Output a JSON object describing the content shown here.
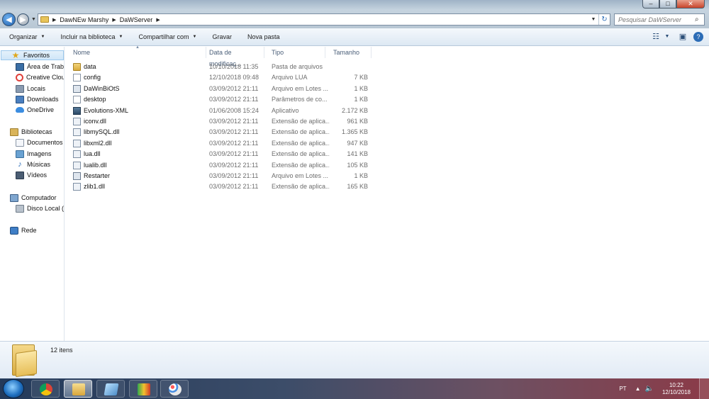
{
  "window": {
    "minimize": "–",
    "maximize": "□",
    "close": "✕"
  },
  "address": {
    "crumbs": [
      "DawNEw Marshy",
      "DaWServer"
    ],
    "search_placeholder": "Pesquisar DaWServer"
  },
  "toolbar": {
    "organize": "Organizar",
    "include_library": "Incluir na biblioteca",
    "share": "Compartilhar com",
    "burn": "Gravar",
    "new_folder": "Nova pasta"
  },
  "nav": {
    "favorites": "Favoritos",
    "desktop": "Área de Traba",
    "creative_cloud": "Creative Clou",
    "places": "Locais",
    "downloads": "Downloads",
    "onedrive": "OneDrive",
    "libraries": "Bibliotecas",
    "documents": "Documentos",
    "images": "Imagens",
    "music": "Músicas",
    "videos": "Vídeos",
    "computer": "Computador",
    "local_disk": "Disco Local (C",
    "network": "Rede"
  },
  "columns": {
    "name": "Nome",
    "date": "Data de modificaç...",
    "type": "Tipo",
    "size": "Tamanho"
  },
  "files": [
    {
      "name": "data",
      "date": "10/10/2018 11:35",
      "type": "Pasta de arquivos",
      "size": "",
      "icon": "folder"
    },
    {
      "name": "config",
      "date": "12/10/2018 09:48",
      "type": "Arquivo LUA",
      "size": "7 KB",
      "icon": "file"
    },
    {
      "name": "DaWinBiOtS",
      "date": "03/09/2012 21:11",
      "type": "Arquivo em Lotes ...",
      "size": "1 KB",
      "icon": "bat"
    },
    {
      "name": "desktop",
      "date": "03/09/2012 21:11",
      "type": "Parâmetros de co...",
      "size": "1 KB",
      "icon": "file"
    },
    {
      "name": "Evolutions-XML",
      "date": "01/06/2008 15:24",
      "type": "Aplicativo",
      "size": "2.172 KB",
      "icon": "app"
    },
    {
      "name": "iconv.dll",
      "date": "03/09/2012 21:11",
      "type": "Extensão de aplica...",
      "size": "961 KB",
      "icon": "dll"
    },
    {
      "name": "libmySQL.dll",
      "date": "03/09/2012 21:11",
      "type": "Extensão de aplica...",
      "size": "1.365 KB",
      "icon": "dll"
    },
    {
      "name": "libxml2.dll",
      "date": "03/09/2012 21:11",
      "type": "Extensão de aplica...",
      "size": "947 KB",
      "icon": "dll"
    },
    {
      "name": "lua.dll",
      "date": "03/09/2012 21:11",
      "type": "Extensão de aplica...",
      "size": "141 KB",
      "icon": "dll"
    },
    {
      "name": "lualib.dll",
      "date": "03/09/2012 21:11",
      "type": "Extensão de aplica...",
      "size": "105 KB",
      "icon": "dll"
    },
    {
      "name": "Restarter",
      "date": "03/09/2012 21:11",
      "type": "Arquivo em Lotes ...",
      "size": "1 KB",
      "icon": "bat"
    },
    {
      "name": "zlib1.dll",
      "date": "03/09/2012 21:11",
      "type": "Extensão de aplica...",
      "size": "165 KB",
      "icon": "dll"
    }
  ],
  "details": {
    "count": "12 itens"
  },
  "taskbar": {
    "language": "PT",
    "time": "10:22",
    "date": "12/10/2018"
  },
  "colors": {
    "selection": "#cfe6f8",
    "toolbar": "#dde8f3",
    "taskbar": "#3c4d69"
  }
}
